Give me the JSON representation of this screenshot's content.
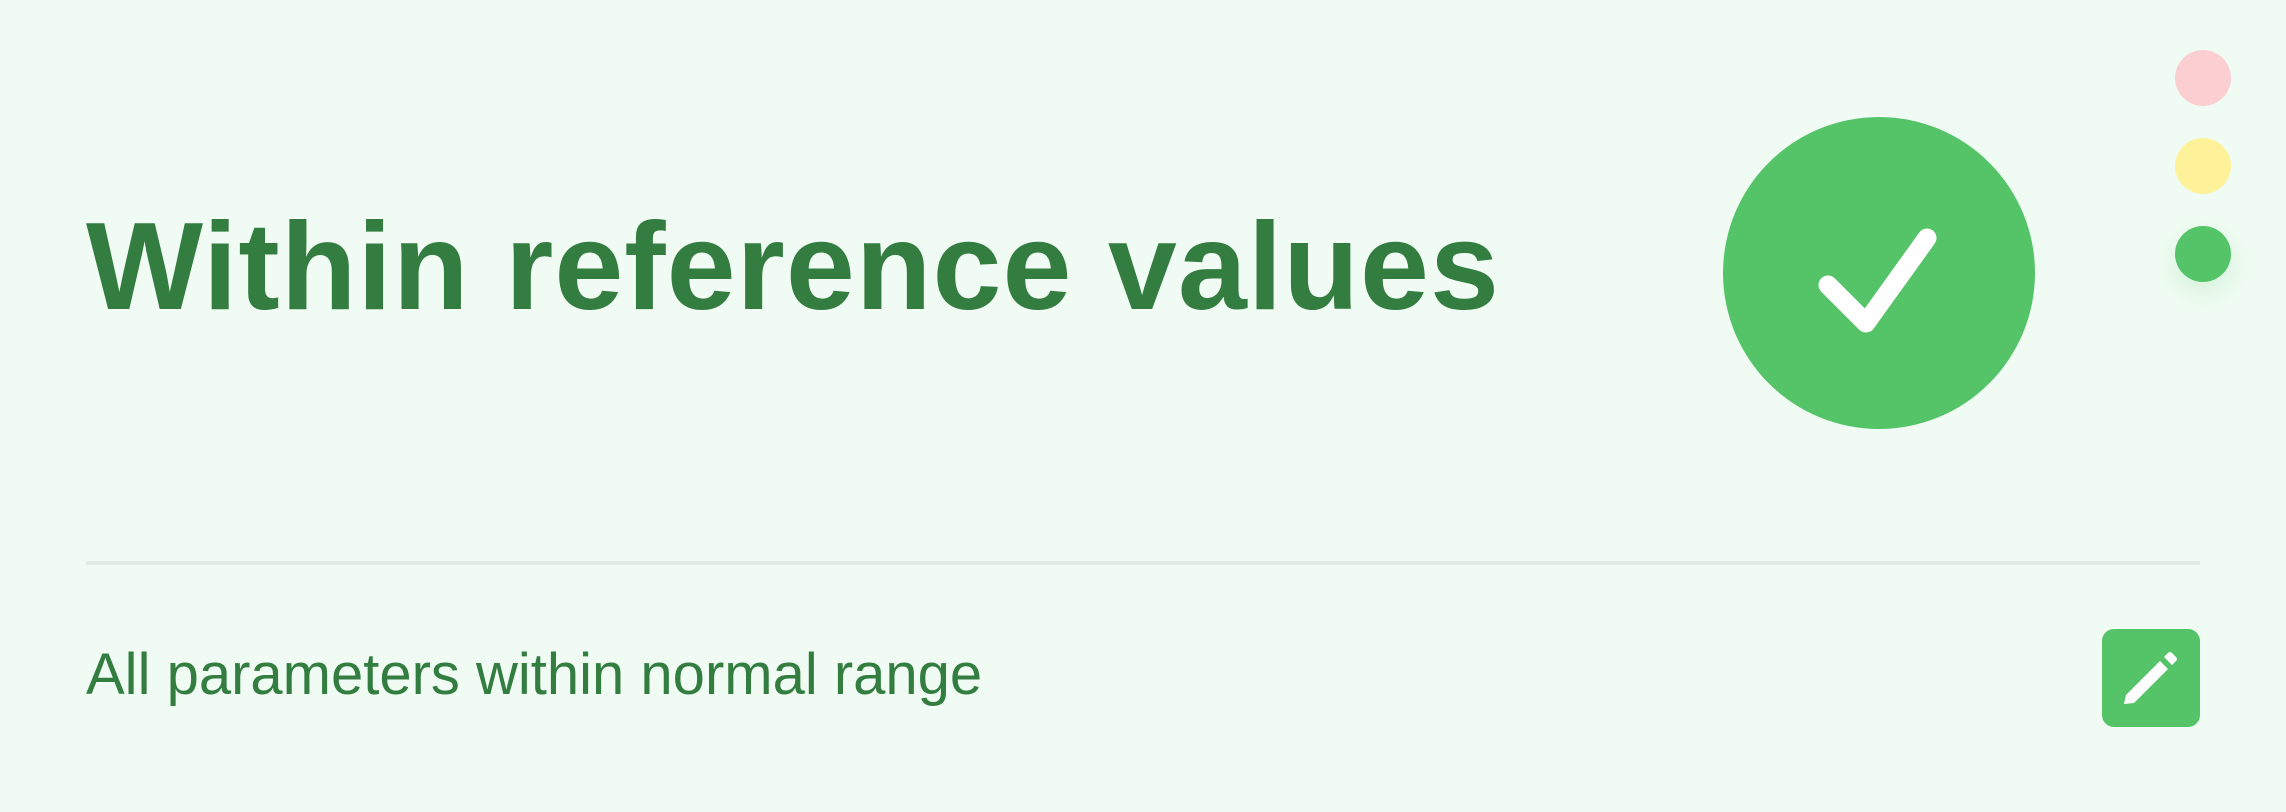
{
  "status": {
    "headline": "Within reference values",
    "description": "All parameters within normal range",
    "level": "green",
    "icon": "check-icon"
  },
  "light_selector": {
    "options": [
      {
        "name": "red",
        "color": "#fbcfd2"
      },
      {
        "name": "yellow",
        "color": "#fdf19a"
      },
      {
        "name": "green",
        "color": "#55c469"
      }
    ],
    "selected": "green"
  },
  "edit_button": {
    "icon": "pencil-icon"
  },
  "colors": {
    "background": "#f0fcf3",
    "accent": "#55c469",
    "text": "#337d41",
    "divider": "#e2ece6"
  }
}
